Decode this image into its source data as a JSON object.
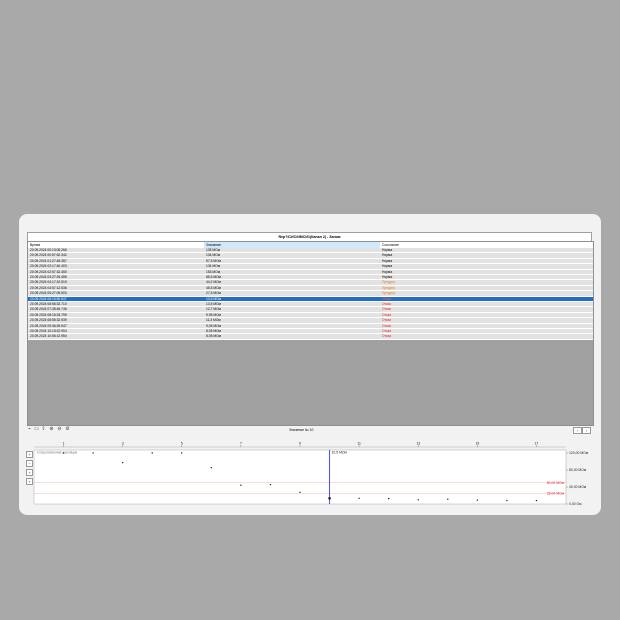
{
  "window": {
    "title": "Rep?ICИC/ИМСИ1(Канал 2) - Заним"
  },
  "table": {
    "columns": [
      "Время",
      "Значение",
      "Состояние"
    ],
    "selected_column": 1,
    "rows": [
      {
        "time": "20.09.2024 00:13:05.266",
        "value": "135 МОм",
        "state": "Норма",
        "status": "norm"
      },
      {
        "time": "20.09.2024 00:57:52.342",
        "value": "134 МОм",
        "state": "Норма",
        "status": "norm"
      },
      {
        "time": "20.09.2024 01:27:45.357",
        "value": "97,5 МОм",
        "state": "Норма",
        "status": "norm"
      },
      {
        "time": "20.09.2024 02:17:40.403",
        "value": "134 МОм",
        "state": "Норма",
        "status": "norm"
      },
      {
        "time": "20.09.2024 02:57:32.450",
        "value": "153 МОм",
        "state": "Норма",
        "status": "norm"
      },
      {
        "time": "20.09.2024 03:27:25.455",
        "value": "85,5 МОм",
        "state": "Норма",
        "status": "norm"
      },
      {
        "time": "20.09.2024 04:17:10.515",
        "value": "44,2 МОм",
        "state": "Предупр.",
        "status": "warn"
      },
      {
        "time": "20.09.2024 04:57:12.536",
        "value": "45,5 МОм",
        "state": "Предупр.",
        "status": "warn"
      },
      {
        "time": "20.09.2024 05:27:05.503",
        "value": "27,5 МОм",
        "state": "Предупр.",
        "status": "warn"
      },
      {
        "time": "20.09.2024 06:15:50.547",
        "value": "13,5 МОм",
        "state": "Отказ",
        "status": "fail",
        "selected": true
      },
      {
        "time": "20.09.2024 06:56:32.710",
        "value": "13,5 МОм",
        "state": "Отказ",
        "status": "fail"
      },
      {
        "time": "20.09.2024 07:35:46.745",
        "value": "12,7 МОм",
        "state": "Отказ",
        "status": "fail"
      },
      {
        "time": "20.09.2024 08:15:33.799",
        "value": "9,95 МОм",
        "state": "Отказ",
        "status": "fail"
      },
      {
        "time": "20.09.2024 08:55:32.939",
        "value": "11,3 МОм",
        "state": "Отказ",
        "status": "fail"
      },
      {
        "time": "20.09.2024 09:36:25.947",
        "value": "9,05 МОм",
        "state": "Отказ",
        "status": "fail"
      },
      {
        "time": "20.09.2024 10:15:22.904",
        "value": "8,05 МОм",
        "state": "Отказ",
        "status": "fail"
      },
      {
        "time": "20.09.2024 10:56:12.954",
        "value": "8,05 МОм",
        "state": "Отказ",
        "status": "fail"
      }
    ]
  },
  "toolbar": {
    "counter_label": "Значение № 10",
    "icons": [
      "chart-line-icon",
      "chart-bar-icon",
      "export-icon",
      "zoom-in-icon",
      "zoom-out-icon",
      "settings-icon"
    ]
  },
  "chart_data": {
    "type": "scatter",
    "legend": "Сопротивление изоляции",
    "x_ticks": [
      "1",
      "3",
      "5",
      "7",
      "9",
      "11",
      "13",
      "15",
      "17"
    ],
    "y_ticks": [
      "120,00 МОм",
      "80,00 МОм",
      "40,00 МОм",
      "0,00 Ом"
    ],
    "ylim": [
      0,
      120
    ],
    "thresholds": [
      {
        "label": "50,00 МОм",
        "value": 50,
        "color": "#e02020"
      },
      {
        "label": "25,00 МОм",
        "value": 25,
        "color": "#e02020"
      }
    ],
    "cursor": {
      "x": 10,
      "label": "10,5 МОм"
    },
    "points": [
      {
        "x": 1,
        "y": 135
      },
      {
        "x": 2,
        "y": 134
      },
      {
        "x": 3,
        "y": 97.5
      },
      {
        "x": 4,
        "y": 134
      },
      {
        "x": 5,
        "y": 153
      },
      {
        "x": 6,
        "y": 85.5
      },
      {
        "x": 7,
        "y": 44.2
      },
      {
        "x": 8,
        "y": 45.5
      },
      {
        "x": 9,
        "y": 27.5
      },
      {
        "x": 10,
        "y": 13.5
      },
      {
        "x": 11,
        "y": 13.5
      },
      {
        "x": 12,
        "y": 12.7
      },
      {
        "x": 13,
        "y": 9.95
      },
      {
        "x": 14,
        "y": 11.3
      },
      {
        "x": 15,
        "y": 9.05
      },
      {
        "x": 16,
        "y": 8.05
      },
      {
        "x": 17,
        "y": 8.05
      }
    ],
    "accent": "#4a4aff"
  }
}
